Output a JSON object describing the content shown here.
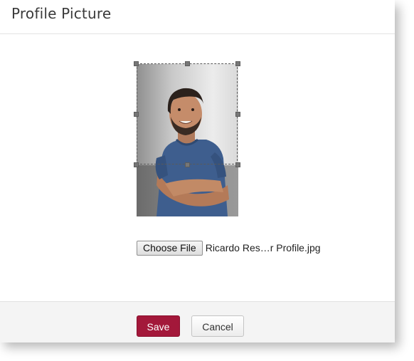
{
  "dialog": {
    "title": "Profile Picture"
  },
  "cropper": {
    "image_subject": "man-in-blue-tshirt-arms-crossed"
  },
  "file_input": {
    "button_label": "Choose File",
    "file_name": "Ricardo Res…r Profile.jpg"
  },
  "footer": {
    "save_label": "Save",
    "cancel_label": "Cancel"
  },
  "colors": {
    "accent": "#a3183a",
    "title": "#3a3a3a",
    "footer_bg": "#f4f4f4",
    "shirt": "#3e5e8e"
  }
}
